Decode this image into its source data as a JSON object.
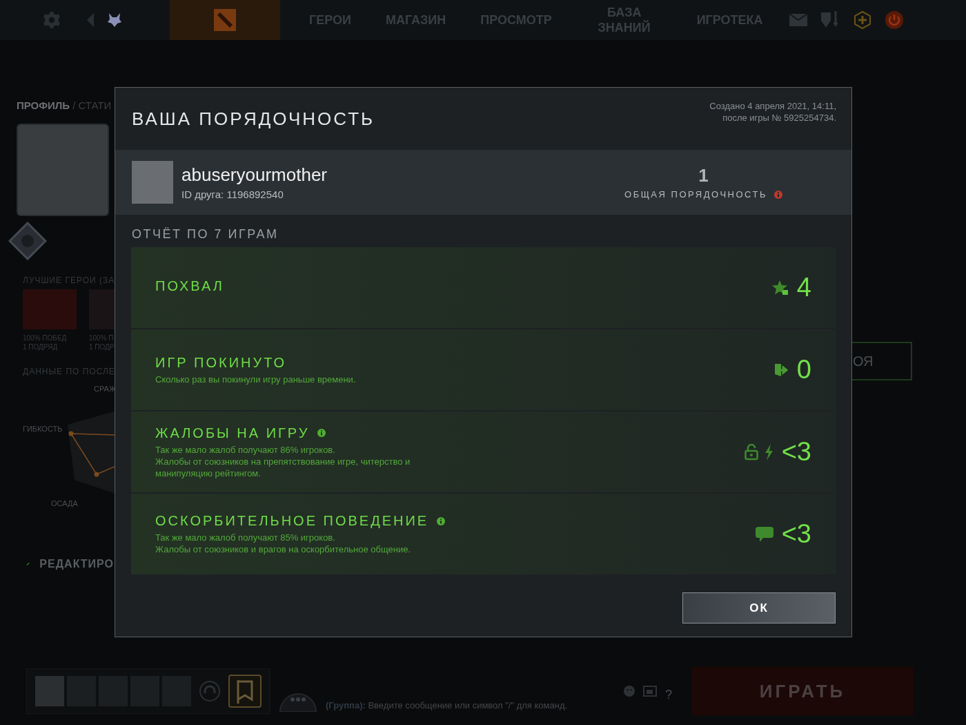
{
  "nav": {
    "items": [
      {
        "label": "ГЕРОИ"
      },
      {
        "label": "МАГАЗИН"
      },
      {
        "label": "ПРОСМОТР"
      },
      {
        "label": "БАЗА ЗНАНИЙ"
      },
      {
        "label": "ИГРОТЕКА"
      }
    ]
  },
  "profile": {
    "breadcrumb": "ПРОФИЛЬ",
    "breadcrumb_next": "/ СТАТИ",
    "best_heroes_title": "ЛУЧШИЕ ГЕРОИ (ЗА",
    "best_heroes": [
      {
        "line1": "100% ПОБЕД",
        "line2": "1 ПОДРЯД"
      },
      {
        "line1": "100% П",
        "line2": "1 ПОДР"
      }
    ],
    "recent_title": "ДАННЫЕ ПО ПОСЛЕ",
    "radar": {
      "top": "СРАЖ",
      "left": "ГИБКОСТЬ",
      "bottom": "ОСАДА"
    },
    "edit": "РЕДАКТИРО"
  },
  "hero_button_fragment": "ОЯ",
  "modal": {
    "title": "ВАША ПОРЯДОЧНОСТЬ",
    "created": "Создано 4 апреля 2021, 14:11,",
    "after_game": "после игры № 5925254734.",
    "player": {
      "name": "abuseryourmother",
      "friend_id": "ID друга: 1196892540"
    },
    "overall": {
      "value": "1",
      "label": "ОБЩАЯ ПОРЯДОЧНОСТЬ"
    },
    "report_title": "ОТЧЁТ ПО 7 ИГРАМ",
    "rows": [
      {
        "kind": "commend",
        "title": "ПОХВАЛ",
        "info": false,
        "lines": [],
        "value": "4"
      },
      {
        "kind": "abandon",
        "title": "ИГР ПОКИНУТО",
        "info": false,
        "lines": [
          "Сколько раз вы покинули игру раньше времени."
        ],
        "value": "0"
      },
      {
        "kind": "gameplay",
        "title": "ЖАЛОБЫ НА ИГРУ",
        "info": true,
        "lines": [
          "Так же мало жалоб получают 86% игроков.",
          "Жалобы от союзников на препятствование игре, читерство и манипуляцию рейтингом."
        ],
        "value": "<3"
      },
      {
        "kind": "communication",
        "title": "ОСКОРБИТЕЛЬНОЕ ПОВЕДЕНИЕ",
        "info": true,
        "lines": [
          "Так же мало жалоб получают 85% игроков.",
          "Жалобы от союзников и врагов на оскорбительное общение."
        ],
        "value": "<3"
      }
    ],
    "ok": "ОК"
  },
  "bottom": {
    "chat_channel": "(Группа):",
    "chat_placeholder": "Введите сообщение или символ \"/\" для команд.",
    "help": "?",
    "play": "ИГРАТЬ"
  }
}
